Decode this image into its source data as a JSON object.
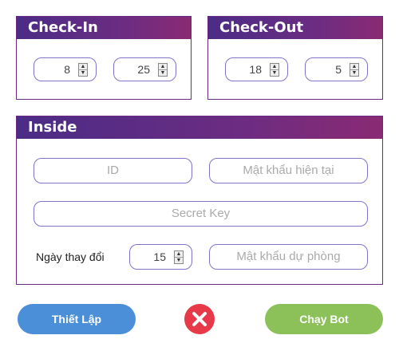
{
  "checkin": {
    "title": "Check-In",
    "hour": "8",
    "minute": "25"
  },
  "checkout": {
    "title": "Check-Out",
    "hour": "18",
    "minute": "5"
  },
  "inside": {
    "title": "Inside",
    "id_placeholder": "ID",
    "password_placeholder": "Mật khẩu hiện tại",
    "secret_placeholder": "Secret Key",
    "change_days_label": "Ngày thay đổi",
    "change_days_value": "15",
    "backup_password_placeholder": "Mật khẩu dự phòng"
  },
  "actions": {
    "setup_label": "Thiết Lập",
    "run_label": "Chạy Bot"
  },
  "colors": {
    "header_start": "#4b2c86",
    "header_end": "#8a2a73",
    "setup": "#4a8fd8",
    "run": "#8cc15a",
    "close": "#e8394a"
  }
}
